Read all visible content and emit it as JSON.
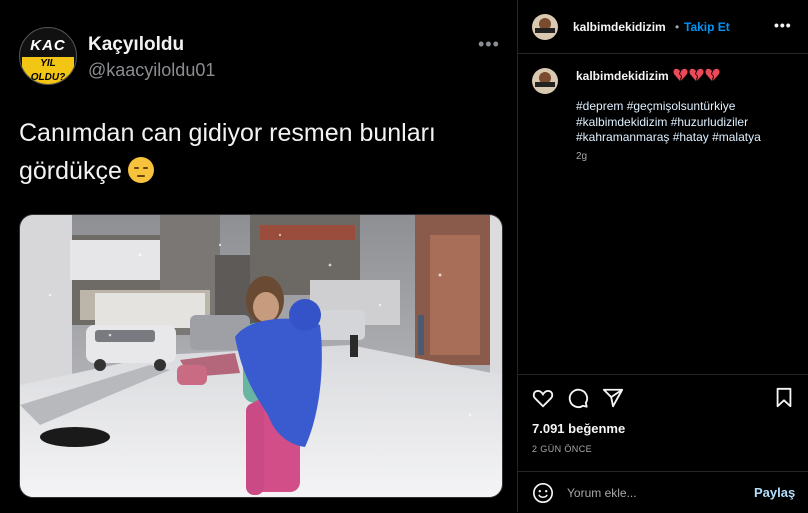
{
  "tweet": {
    "avatar_line1": "KAC",
    "avatar_line2": "YIL OLDU?",
    "display_name": "Kaçyıloldu",
    "handle": "@kaacyiloldu01",
    "more_icon": "more-horizontal-icon",
    "text": "Canımdan can gidiyor resmen bunları gördükçe",
    "emoji": "pensive-face-emoji"
  },
  "instagram": {
    "header_username": "kalbimdekidizim",
    "header_separator": "•",
    "follow_label": "Takip Et",
    "caption_username": "kalbimdekidizim",
    "caption_hearts": "broken-heart-icon x3",
    "hashtags_line1": "#deprem #geçmişolsuntürkiye",
    "hashtags_line2": "#kalbimdekidizim #huzurludiziler",
    "hashtags_line3": "#kahramanmaraş #hatay #malatya",
    "caption_time": "2g",
    "likes": "7.091 beğenme",
    "posted_ago": "2 GÜN ÖNCE",
    "comment_placeholder": "Yorum ekle...",
    "post_label": "Paylaş",
    "colors": {
      "follow": "#0095f6",
      "post": "#b2dffc",
      "heart": "#ed4956"
    }
  }
}
